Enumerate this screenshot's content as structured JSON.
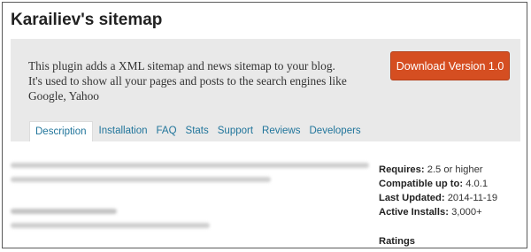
{
  "page": {
    "title": "Karailiev's sitemap"
  },
  "banner": {
    "description": "This plugin adds a XML sitemap and news sitemap to your blog. It's used to show all your pages and posts to the search engines like Google, Yahoo",
    "download_label": "Download Version 1.0"
  },
  "tabs": [
    {
      "label": "Description",
      "active": true
    },
    {
      "label": "Installation",
      "active": false
    },
    {
      "label": "FAQ",
      "active": false
    },
    {
      "label": "Stats",
      "active": false
    },
    {
      "label": "Support",
      "active": false
    },
    {
      "label": "Reviews",
      "active": false
    },
    {
      "label": "Developers",
      "active": false
    }
  ],
  "meta": {
    "requires_label": "Requires:",
    "requires_value": "2.5 or higher",
    "compatible_label": "Compatible up to:",
    "compatible_value": "4.0.1",
    "updated_label": "Last Updated:",
    "updated_value": "2014-11-19",
    "installs_label": "Active Installs:",
    "installs_value": "3,000+",
    "ratings_label": "Ratings"
  },
  "colors": {
    "accent_button": "#d54e21",
    "link": "#21759b",
    "banner_bg": "#e9e9e9"
  }
}
